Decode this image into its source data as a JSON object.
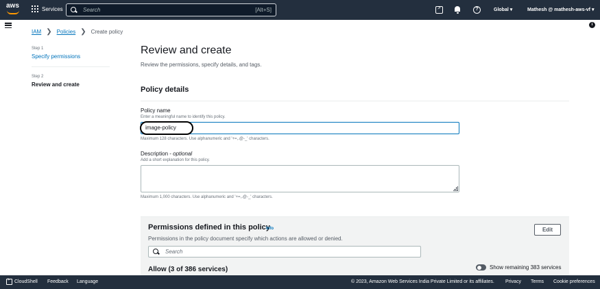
{
  "topnav": {
    "logo_text": "aws",
    "services_label": "Services",
    "search_placeholder": "Search",
    "search_shortcut": "[Alt+S]",
    "region_label": "Global ▾",
    "account_label": "Mathesh @ mathesh-aws-vf ▾",
    "help_glyph": "?"
  },
  "breadcrumb": {
    "items": [
      "IAM",
      "Policies",
      "Create policy"
    ],
    "separator": "❯"
  },
  "steps": [
    {
      "label": "Step 1",
      "title": "Specify permissions"
    },
    {
      "label": "Step 2",
      "title": "Review and create"
    }
  ],
  "page": {
    "title": "Review and create",
    "subtitle": "Review the permissions, specify details, and tags."
  },
  "policy_details": {
    "title": "Policy details",
    "name_label": "Policy name",
    "name_hint": "Enter a meaningful name to identify this policy.",
    "name_value": "image-policy",
    "name_constraint": "Maximum 128 characters. Use alphanumeric and '+=,.@-_' characters.",
    "desc_label": "Description - ",
    "desc_optional": "optional",
    "desc_hint": "Add a short explanation for this policy.",
    "desc_constraint": "Maximum 1,000 characters. Use alphanumeric and '+=,.@-_' characters."
  },
  "permissions": {
    "title": "Permissions defined in this policy",
    "info": "Info",
    "description": "Permissions in the policy document specify which actions are allowed or denied.",
    "edit_label": "Edit",
    "search_placeholder": "Search",
    "allow_title": "Allow (3 of 386 services)",
    "toggle_label": "Show remaining 383 services"
  },
  "footer": {
    "cloudshell": "CloudShell",
    "feedback": "Feedback",
    "language": "Language",
    "copyright": "© 2023, Amazon Web Services India Private Limited or its affiliates.",
    "privacy": "Privacy",
    "terms": "Terms",
    "cookies": "Cookie preferences"
  },
  "colors": {
    "nav_bg": "#232f3e",
    "link": "#0073bb",
    "accent": "#ff9900",
    "panel_bg": "#f2f3f3"
  }
}
